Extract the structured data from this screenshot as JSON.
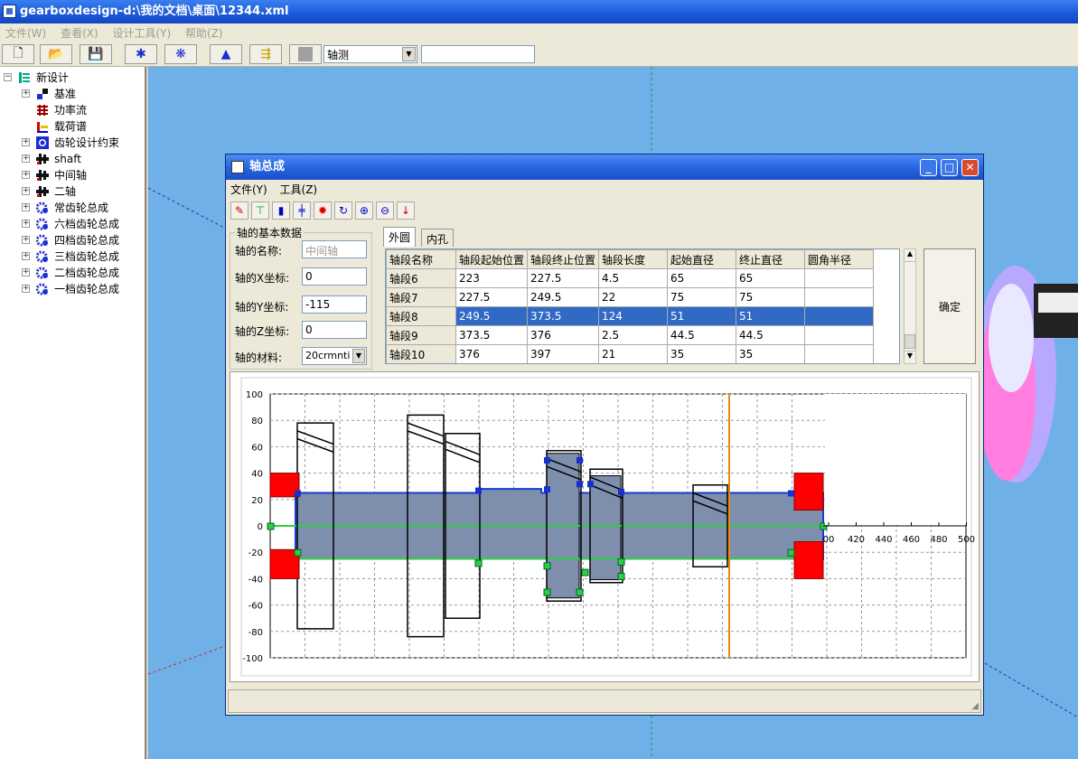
{
  "app": {
    "title": "gearboxdesign-d:\\我的文档\\桌面\\12344.xml"
  },
  "menu": [
    "文件(W)",
    "查看(X)",
    "设计工具(Y)",
    "帮助(Z)"
  ],
  "toolbar": {
    "view_select": "轴测",
    "view_input": ""
  },
  "tree": {
    "root": "新设计",
    "items": [
      {
        "label": "基准",
        "icon": "datum-icon",
        "expandable": true
      },
      {
        "label": "功率流",
        "icon": "power-flow-icon",
        "expandable": false
      },
      {
        "label": "载荷谱",
        "icon": "load-spectrum-icon",
        "expandable": false
      },
      {
        "label": "齿轮设计约束",
        "icon": "constraint-icon",
        "expandable": true
      },
      {
        "label": "shaft",
        "icon": "shaft-icon",
        "expandable": true
      },
      {
        "label": "中间轴",
        "icon": "shaft-icon",
        "expandable": true
      },
      {
        "label": "二轴",
        "icon": "shaft-icon",
        "expandable": true
      },
      {
        "label": "常齿轮总成",
        "icon": "gear-icon",
        "expandable": true
      },
      {
        "label": "六档齿轮总成",
        "icon": "gear-icon",
        "expandable": true
      },
      {
        "label": "四档齿轮总成",
        "icon": "gear-icon",
        "expandable": true
      },
      {
        "label": "三档齿轮总成",
        "icon": "gear-icon",
        "expandable": true
      },
      {
        "label": "二档齿轮总成",
        "icon": "gear-icon",
        "expandable": true
      },
      {
        "label": "一档齿轮总成",
        "icon": "gear-icon",
        "expandable": true
      }
    ]
  },
  "window": {
    "title": "轴总成",
    "menu": [
      "文件(Y)",
      "工具(Z)"
    ],
    "basic_group": "轴的基本数据",
    "fields": {
      "name_label": "轴的名称:",
      "name_value": "中间轴",
      "x_label": "轴的X坐标:",
      "x_value": "0",
      "y_label": "轴的Y坐标:",
      "y_value": "-115",
      "z_label": "轴的Z坐标:",
      "z_value": "0",
      "material_label": "轴的材料:",
      "material_value": "20crmnti"
    },
    "tabs": [
      "外圆",
      "内孔"
    ],
    "table": {
      "headers": [
        "轴段名称",
        "轴段起始位置",
        "轴段终止位置",
        "轴段长度",
        "起始直径",
        "终止直径",
        "圆角半径"
      ],
      "rows": [
        [
          "轴段6",
          "223",
          "227.5",
          "4.5",
          "65",
          "65",
          ""
        ],
        [
          "轴段7",
          "227.5",
          "249.5",
          "22",
          "75",
          "75",
          ""
        ],
        [
          "轴段8",
          "249.5",
          "373.5",
          "124",
          "51",
          "51",
          ""
        ],
        [
          "轴段9",
          "373.5",
          "376",
          "2.5",
          "44.5",
          "44.5",
          ""
        ],
        [
          "轴段10",
          "376",
          "397",
          "21",
          "35",
          "35",
          ""
        ]
      ],
      "selected_row": 2
    },
    "ok_button": "确定"
  },
  "chart_data": {
    "type": "line",
    "ylim": [
      -100,
      100
    ],
    "xlim_visible_ticks": [
      400,
      420,
      440,
      460,
      480,
      500
    ],
    "y_ticks": [
      100,
      80,
      60,
      40,
      20,
      0,
      -20,
      -40,
      -60,
      -80,
      -100
    ],
    "x_ticks": [
      "00",
      "420",
      "440",
      "460",
      "480",
      "500"
    ],
    "grid": true
  }
}
